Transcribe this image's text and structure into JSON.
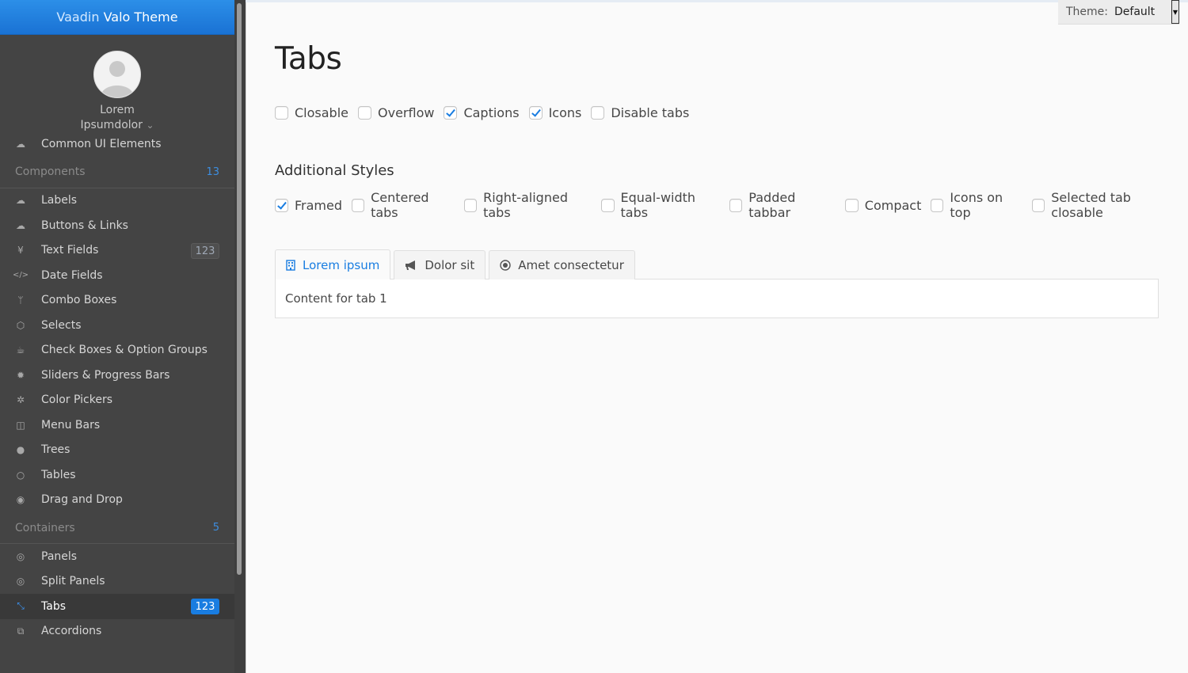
{
  "app": {
    "title_light": "Vaadin",
    "title_bold": "Valo Theme"
  },
  "user": {
    "first": "Lorem",
    "last": "Ipsumdolor",
    "chevron": "⌄"
  },
  "menu": {
    "top_item": {
      "label": "Common UI Elements",
      "icon": "cloud-icon"
    },
    "components": {
      "label": "Components",
      "count": "13",
      "items": [
        {
          "label": "Labels",
          "icon": "cloud-download-icon",
          "badge": ""
        },
        {
          "label": "Buttons & Links",
          "icon": "cloud-upload-icon",
          "badge": ""
        },
        {
          "label": "Text Fields",
          "icon": "yen-icon",
          "badge": "123"
        },
        {
          "label": "Date Fields",
          "icon": "code-icon",
          "badge": ""
        },
        {
          "label": "Combo Boxes",
          "icon": "code-fork-icon",
          "badge": ""
        },
        {
          "label": "Selects",
          "icon": "cube-icon",
          "badge": ""
        },
        {
          "label": "Check Boxes & Option Groups",
          "icon": "coffee-icon",
          "badge": ""
        },
        {
          "label": "Sliders & Progress Bars",
          "icon": "cog-icon",
          "badge": ""
        },
        {
          "label": "Color Pickers",
          "icon": "cogs-icon",
          "badge": ""
        },
        {
          "label": "Menu Bars",
          "icon": "columns-icon",
          "badge": ""
        },
        {
          "label": "Trees",
          "icon": "comment-icon",
          "badge": ""
        },
        {
          "label": "Tables",
          "icon": "comment-outline-icon",
          "badge": ""
        },
        {
          "label": "Drag and Drop",
          "icon": "comments-icon",
          "badge": ""
        }
      ]
    },
    "containers": {
      "label": "Containers",
      "count": "5",
      "items": [
        {
          "label": "Panels",
          "icon": "comments-outline-icon",
          "badge": ""
        },
        {
          "label": "Split Panels",
          "icon": "compass-icon",
          "badge": ""
        },
        {
          "label": "Tabs",
          "icon": "compress-icon",
          "badge": "123",
          "selected": true
        },
        {
          "label": "Accordions",
          "icon": "copy-icon",
          "badge": ""
        }
      ]
    }
  },
  "theme": {
    "label": "Theme:",
    "value": "Default"
  },
  "page": {
    "title": "Tabs",
    "options": [
      {
        "label": "Closable",
        "checked": false
      },
      {
        "label": "Overflow",
        "checked": false
      },
      {
        "label": "Captions",
        "checked": true
      },
      {
        "label": "Icons",
        "checked": true
      },
      {
        "label": "Disable tabs",
        "checked": false
      }
    ],
    "additional_styles_heading": "Additional Styles",
    "styles": [
      {
        "label": "Framed",
        "checked": true
      },
      {
        "label": "Centered tabs",
        "checked": false
      },
      {
        "label": "Right-aligned tabs",
        "checked": false
      },
      {
        "label": "Equal-width tabs",
        "checked": false
      },
      {
        "label": "Padded tabbar",
        "checked": false
      },
      {
        "label": "Compact",
        "checked": false
      },
      {
        "label": "Icons on top",
        "checked": false
      },
      {
        "label": "Selected tab closable",
        "checked": false
      }
    ],
    "tabs": [
      {
        "label": "Lorem ipsum",
        "icon": "building-icon",
        "selected": true
      },
      {
        "label": "Dolor sit",
        "icon": "bullhorn-icon",
        "selected": false
      },
      {
        "label": "Amet consectetur",
        "icon": "bullseye-icon",
        "selected": false
      }
    ],
    "tab_content": "Content for tab 1"
  },
  "colors": {
    "accent": "#197de1",
    "sidebar_bg": "#444444",
    "header_blue": "#1a72d4"
  }
}
